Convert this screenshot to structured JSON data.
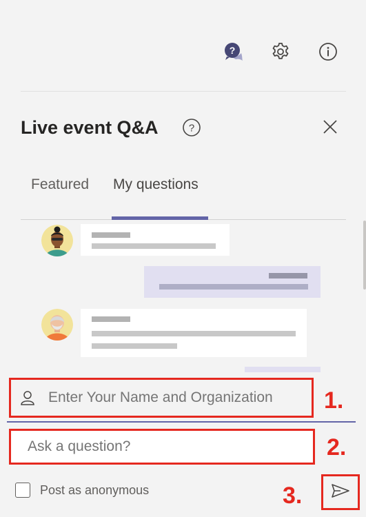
{
  "topbar": {
    "icons": [
      "qa-bubble-icon",
      "gear-icon",
      "info-icon"
    ]
  },
  "header": {
    "title": "Live event Q&A"
  },
  "tabs": [
    {
      "label": "Featured",
      "selected": false
    },
    {
      "label": "My questions",
      "selected": true
    }
  ],
  "composer": {
    "name_placeholder": "Enter Your Name and Organization",
    "question_placeholder": "Ask a question?",
    "anonymous_label": "Post as anonymous",
    "anonymous_checked": false
  },
  "annotations": {
    "step1": "1.",
    "step2": "2.",
    "step3": "3."
  },
  "colors": {
    "accent": "#6264a7",
    "highlight": "#e5281f",
    "background": "#f3f3f3",
    "my_bubble": "#e1dff1"
  }
}
